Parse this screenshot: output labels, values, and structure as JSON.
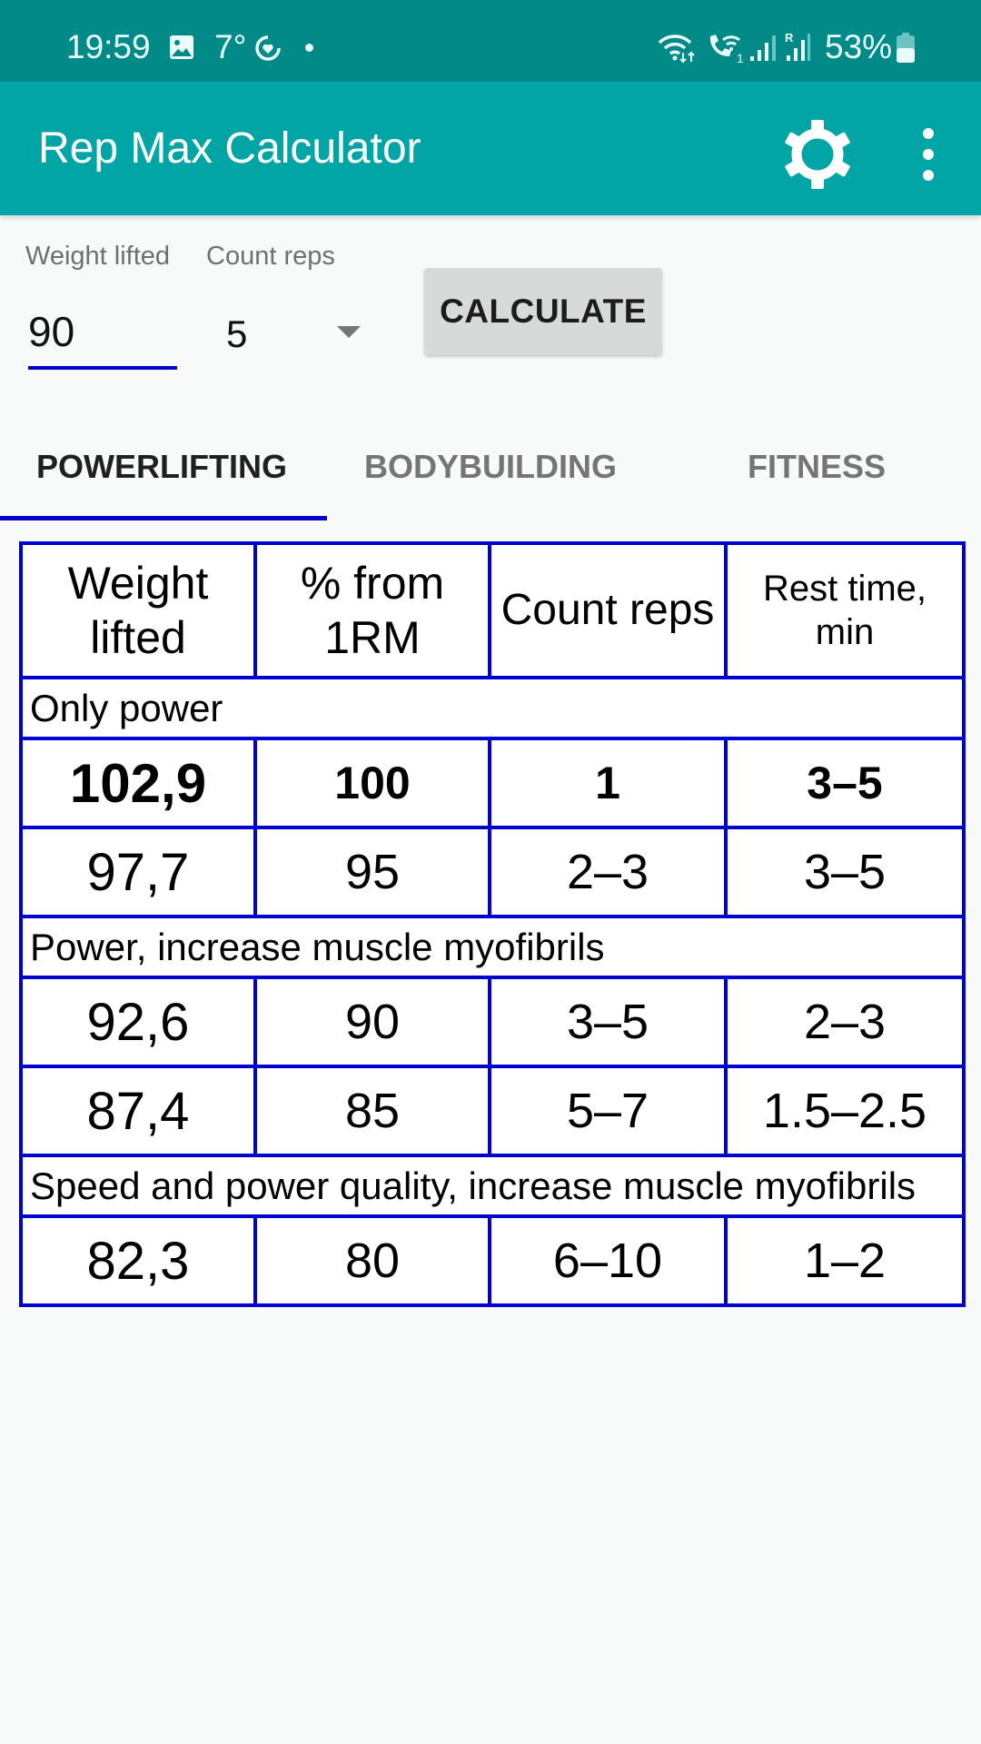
{
  "status_bar": {
    "time": "19:59",
    "temperature": "7°",
    "battery_percent": "53%",
    "icons": [
      "image-icon",
      "weather-temp",
      "health-ring-icon",
      "notification-dot-icon",
      "wifi-data-icon",
      "wifi-calling-icon",
      "signal-icon",
      "roaming-signal-icon",
      "battery-icon"
    ]
  },
  "app_bar": {
    "title": "Rep Max Calculator",
    "actions": [
      "gear-icon",
      "more-vert-icon"
    ]
  },
  "form": {
    "weight_label": "Weight lifted",
    "weight_value": "90",
    "reps_label": "Count reps",
    "reps_value": "5",
    "calculate_label": "CALCULATE"
  },
  "tabs": [
    {
      "label": "POWERLIFTING",
      "active": true
    },
    {
      "label": "BODYBUILDING",
      "active": false
    },
    {
      "label": "FITNESS",
      "active": false
    }
  ],
  "table": {
    "headers": [
      "Weight lifted",
      "% from 1RM",
      "Count reps",
      "Rest time, min"
    ],
    "groups": [
      {
        "title": "Only power",
        "rows": [
          [
            "102,9",
            "100",
            "1",
            "3–5"
          ],
          [
            "97,7",
            "95",
            "2–3",
            "3–5"
          ]
        ]
      },
      {
        "title": "Power, increase muscle myofibrils",
        "rows": [
          [
            "92,6",
            "90",
            "3–5",
            "2–3"
          ],
          [
            "87,4",
            "85",
            "5–7",
            "1.5–2.5"
          ]
        ]
      },
      {
        "title": "Speed and power quality, increase muscle myofibrils",
        "rows": [
          [
            "82,3",
            "80",
            "6–10",
            "1–2"
          ]
        ]
      }
    ]
  },
  "colors": {
    "status_bar": "#018a88",
    "app_bar": "#02a5a5",
    "accent": "#0000c8",
    "table_border": "#0000d0"
  }
}
